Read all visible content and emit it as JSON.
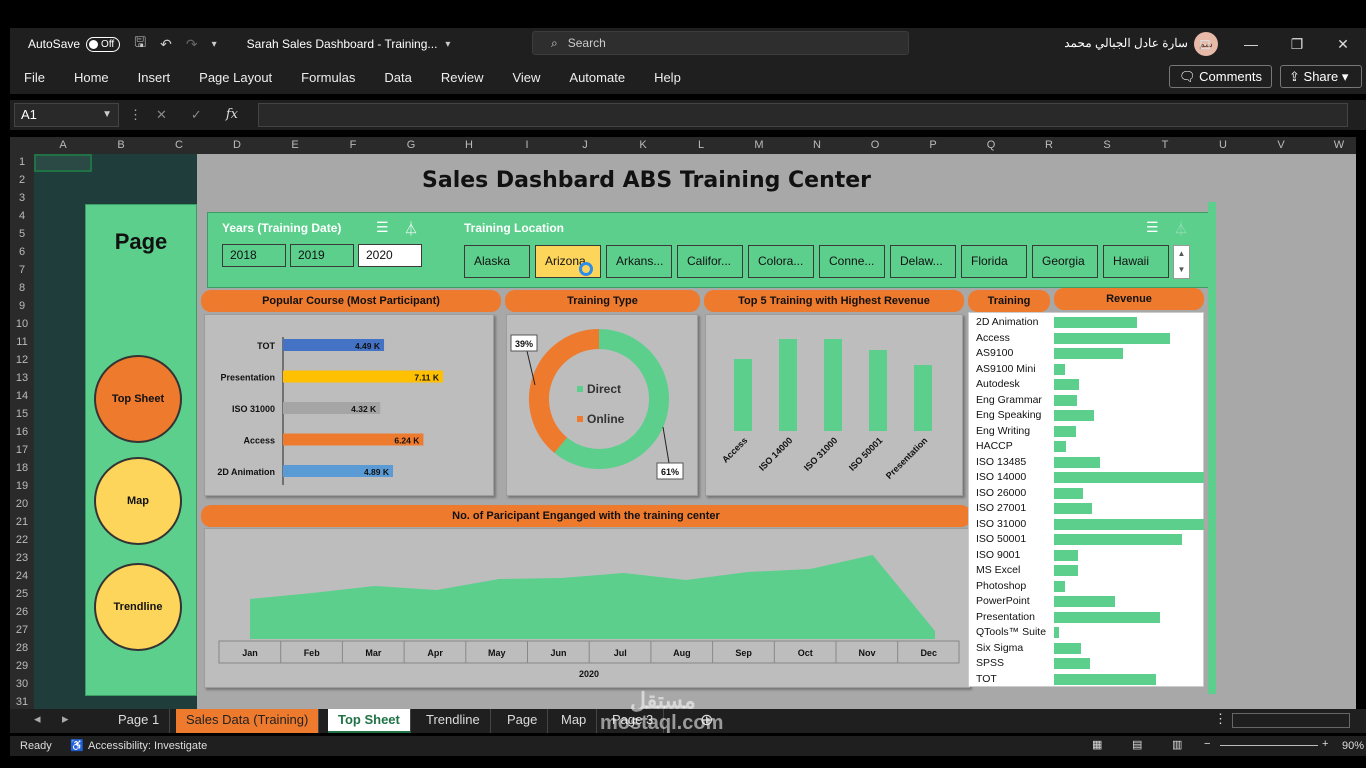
{
  "titlebar": {
    "autosave_label": "AutoSave",
    "autosave_state": "Off",
    "doc_title": "Sarah Sales Dashboard - Training...",
    "search_placeholder": "Search",
    "user_name": "سارة عادل الجبالي محمد",
    "avatar_initials": "سم"
  },
  "menu": [
    "File",
    "Home",
    "Insert",
    "Page Layout",
    "Formulas",
    "Data",
    "Review",
    "View",
    "Automate",
    "Help"
  ],
  "ribbon_buttons": {
    "comments": "Comments",
    "share": "Share"
  },
  "formula_bar": {
    "name_box": "A1",
    "formula": ""
  },
  "columns": [
    "A",
    "B",
    "C",
    "D",
    "E",
    "F",
    "G",
    "H",
    "I",
    "J",
    "K",
    "L",
    "M",
    "N",
    "O",
    "P",
    "Q",
    "R",
    "S",
    "T",
    "U",
    "V",
    "W"
  ],
  "rows": [
    "1",
    "2",
    "3",
    "4",
    "5",
    "6",
    "7",
    "8",
    "9",
    "10",
    "11",
    "12",
    "13",
    "14",
    "15",
    "16",
    "17",
    "18",
    "19",
    "20",
    "21",
    "22",
    "23",
    "24",
    "25",
    "26",
    "27",
    "28",
    "29",
    "30",
    "31"
  ],
  "nav_panel": {
    "title": "Page",
    "buttons": [
      "Top Sheet",
      "Map",
      "Trendline"
    ]
  },
  "dashboard_title": "Sales Dashbard ABS Training Center",
  "slicers": {
    "years_label": "Years (Training Date)",
    "years": [
      "2018",
      "2019",
      "2020"
    ],
    "selected_year": "2020",
    "location_label": "Training Location",
    "locations": [
      "Alaska",
      "Arizona",
      "Arkans...",
      "Califor...",
      "Colora...",
      "Conne...",
      "Delaw...",
      "Florida",
      "Georgia",
      "Hawaii"
    ],
    "selected_location": "Arizona"
  },
  "headers": {
    "popular": "Popular Course (Most Participant)",
    "training_type": "Training Type",
    "top5": "Top 5 Training with Highest Revenue",
    "training": "Training",
    "revenue": "Revenue",
    "participants": "No. of Paricipant Enganged with the training center"
  },
  "colors": {
    "green": "#5ccf8d",
    "orange": "#ee7a2e",
    "yellow": "#fdd55b",
    "blue": "#4472c4",
    "gold": "#ffc000",
    "grey": "#a5a5a5",
    "lightblue": "#5b9bd5"
  },
  "chart_data": [
    {
      "type": "bar",
      "orientation": "horizontal",
      "title": "Popular Course (Most Participant)",
      "categories": [
        "TOT",
        "Presentation",
        "ISO 31000",
        "Access",
        "2D Animation"
      ],
      "values": [
        4.49,
        7.11,
        4.32,
        6.24,
        4.89
      ],
      "labels": [
        "4.49 K",
        "7.11 K",
        "4.32 K",
        "6.24 K",
        "4.89 K"
      ],
      "bar_colors": [
        "#4472c4",
        "#ffc000",
        "#a5a5a5",
        "#ee7a2e",
        "#5b9bd5"
      ]
    },
    {
      "type": "pie",
      "subtype": "donut",
      "title": "Training Type",
      "categories": [
        "Direct",
        "Online"
      ],
      "values": [
        61,
        39
      ],
      "labels": [
        "61%",
        "39%"
      ],
      "colors": [
        "#5ccf8d",
        "#ee7a2e"
      ]
    },
    {
      "type": "bar",
      "title": "Top 5 Training with Highest Revenue",
      "categories": [
        "Access",
        "ISO 14000",
        "ISO 31000",
        "ISO 50001",
        "Presentation"
      ],
      "values": [
        72,
        92,
        92,
        81,
        66
      ],
      "color": "#5ccf8d"
    },
    {
      "type": "area",
      "title": "No. of Paricipant Enganged with the training center",
      "x": [
        "Jan",
        "Feb",
        "Mar",
        "Apr",
        "May",
        "Jun",
        "Jul",
        "Aug",
        "Sep",
        "Oct",
        "Nov",
        "Dec"
      ],
      "xlabel": "2020",
      "values": [
        40,
        46,
        53,
        49,
        60,
        61,
        66,
        59,
        67,
        70,
        84,
        8
      ],
      "color": "#5ccf8d"
    },
    {
      "type": "bar",
      "orientation": "horizontal",
      "title": "Revenue",
      "categories": [
        "2D Animation",
        "Access",
        "AS9100",
        "AS9100 Mini",
        "Autodesk",
        "Eng Grammar",
        "Eng Speaking",
        "Eng Writing",
        "HACCP",
        "ISO 13485",
        "ISO 14000",
        "ISO 26000",
        "ISO 27001",
        "ISO 31000",
        "ISO 50001",
        "ISO 9001",
        "MS Excel",
        "Photoshop",
        "PowerPoint",
        "Presentation",
        "QTools™ Suite",
        "Six Sigma",
        "SPSS",
        "TOT"
      ],
      "values": [
        83,
        116,
        69,
        11,
        25,
        23,
        40,
        22,
        12,
        46,
        150,
        29,
        38,
        150,
        128,
        24,
        24,
        11,
        61,
        106,
        5,
        27,
        36,
        102
      ],
      "color": "#5ccf8d"
    }
  ],
  "tabs": [
    "Page 1",
    "Sales Data (Training)",
    "Top Sheet",
    "Trendline",
    "Page",
    "Map",
    "Page 3"
  ],
  "active_tab": "Top Sheet",
  "status": {
    "ready": "Ready",
    "accessibility": "Accessibility: Investigate",
    "zoom": "90%"
  },
  "watermark": {
    "arabic": "مستقل",
    "site": "mostaql.com"
  }
}
